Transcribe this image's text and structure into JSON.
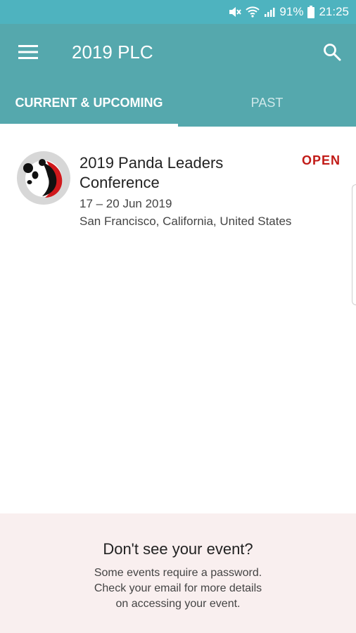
{
  "status_bar": {
    "battery": "91%",
    "time": "21:25",
    "icons": [
      "mute-icon",
      "wifi-icon",
      "signal-icon",
      "battery-icon"
    ]
  },
  "app_bar": {
    "title": "2019 PLC",
    "icons": [
      "menu-icon",
      "search-icon"
    ]
  },
  "tabs": [
    {
      "label": "CURRENT & UPCOMING",
      "selected": true
    },
    {
      "label": "PAST",
      "selected": false
    }
  ],
  "events": [
    {
      "title_line1": "2019 Panda Leaders",
      "title_line2": "Conference",
      "status": "OPEN",
      "dates": "17 – 20 Jun 2019",
      "location": "San Francisco, California, United States"
    }
  ],
  "footer": {
    "title": "Don't see your event?",
    "lines": [
      "Some events require a password.",
      "Check your email for more details",
      "on accessing your event."
    ]
  },
  "colors": {
    "status_bar": "#4eb3bf",
    "app_bar": "#55a8ad",
    "status_open": "#c11b17",
    "footer_bg": "#f9efef"
  }
}
